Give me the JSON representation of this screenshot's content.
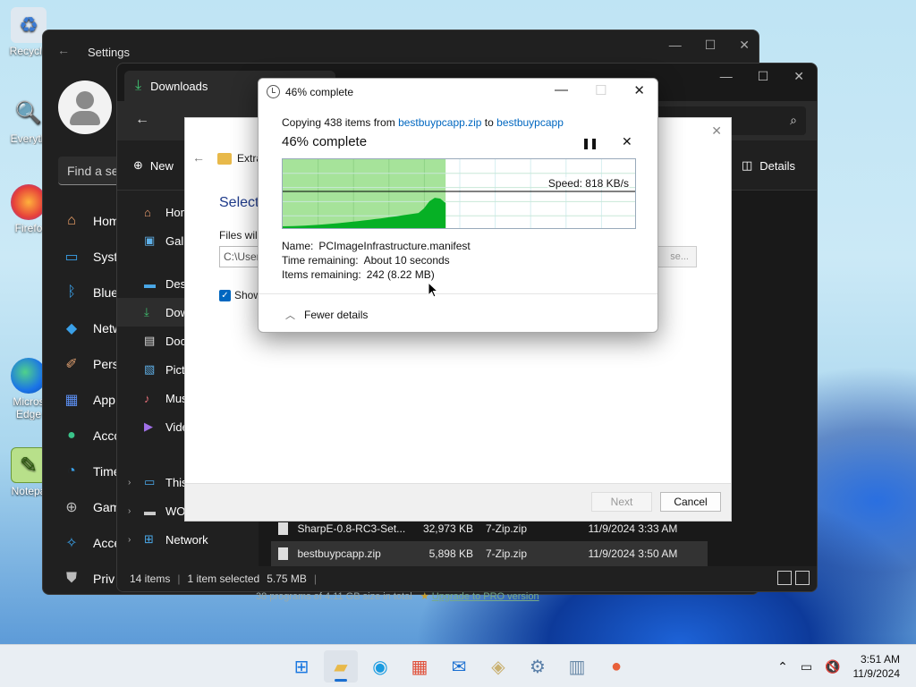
{
  "desktop": {
    "icons": [
      {
        "label": "Recycle",
        "icon": "recycle-bin-icon"
      },
      {
        "label": "Everyth",
        "icon": "everything-search-icon"
      },
      {
        "label": "Firefo",
        "icon": "firefox-icon"
      },
      {
        "label": "Micros Edge",
        "icon": "edge-icon"
      },
      {
        "label": "Notepa",
        "icon": "notepad-icon"
      }
    ]
  },
  "settings": {
    "title": "Settings",
    "search_placeholder": "Find a se",
    "nav": [
      "Hom",
      "Syst",
      "Blue",
      "Netw",
      "Pers",
      "App",
      "Acco",
      "Time",
      "Gam",
      "Acce",
      "Priv"
    ]
  },
  "explorer": {
    "tab_label": "Downloads",
    "new_label": "New",
    "details_label": "Details",
    "sidebar": [
      {
        "label": "Hom",
        "icon": "home-icon"
      },
      {
        "label": "Gall",
        "icon": "gallery-icon"
      },
      {
        "label": "Desk",
        "icon": "desktop-icon"
      },
      {
        "label": "Dow",
        "icon": "download-icon",
        "selected": true
      },
      {
        "label": "Docu",
        "icon": "document-icon"
      },
      {
        "label": "Pict",
        "icon": "pictures-icon"
      },
      {
        "label": "Musi",
        "icon": "music-icon"
      },
      {
        "label": "Vide",
        "icon": "videos-icon"
      },
      {
        "label": "This",
        "icon": "this-pc-icon",
        "chevron": true
      },
      {
        "label": "WORMS ARMAG",
        "icon": "drive-icon",
        "chevron": true
      },
      {
        "label": "Network",
        "icon": "network-icon",
        "chevron": true
      }
    ],
    "rows": [
      {
        "name": "SharpE-0.8-RC3-Set...",
        "size": "32,973 KB",
        "type": "7-Zip.zip",
        "date": "11/9/2024 3:33 AM"
      },
      {
        "name": "bestbuypcapp.zip",
        "size": "5,898 KB",
        "type": "7-Zip.zip",
        "date": "11/9/2024 3:50 AM",
        "selected": true
      }
    ],
    "status": {
      "count": "14 items",
      "selected": "1 item selected",
      "size": "5.75 MB"
    }
  },
  "wizard": {
    "folder_label": "Extra",
    "heading": "Select",
    "files_label": "Files will",
    "path_value": "C:\\User",
    "browse_label": "se...",
    "show_label": "Show",
    "next_label": "Next",
    "cancel_label": "Cancel"
  },
  "copy_dialog": {
    "title": "46% complete",
    "copying_prefix": "Copying 438 items from ",
    "source": "bestbuypcapp.zip",
    "to_word": " to ",
    "destination": "bestbuypcapp",
    "percent_text": "46% complete",
    "progress": 0.46,
    "speed": "Speed: 818 KB/s",
    "name_key": "Name:",
    "name_val": "PCImageInfrastructure.manifest",
    "time_key": "Time remaining:",
    "time_val": "About 10 seconds",
    "items_key": "Items remaining:",
    "items_val": "242 (8.22 MB)",
    "fewer_details": "Fewer details"
  },
  "background_ad": {
    "text": "38 programs of 4.11 GB size in total",
    "link": "Upgrade to PRO version"
  },
  "taskbar": {
    "time": "3:51 AM",
    "date": "11/9/2024",
    "colors": {
      "accent": "#1a6fd1",
      "progress_green": "#06b025"
    }
  }
}
